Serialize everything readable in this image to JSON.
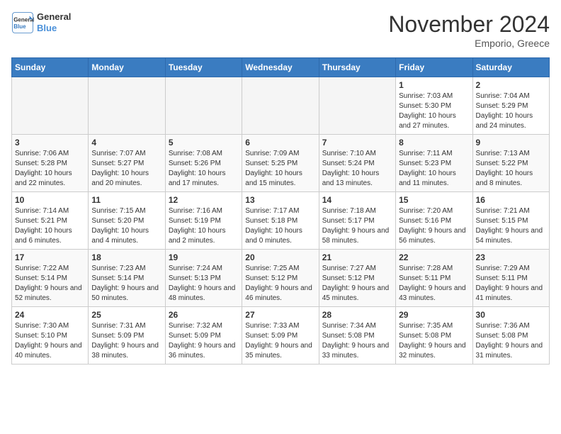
{
  "header": {
    "logo_line1": "General",
    "logo_line2": "Blue",
    "month_title": "November 2024",
    "location": "Emporio, Greece"
  },
  "weekdays": [
    "Sunday",
    "Monday",
    "Tuesday",
    "Wednesday",
    "Thursday",
    "Friday",
    "Saturday"
  ],
  "weeks": [
    [
      {
        "day": "",
        "info": ""
      },
      {
        "day": "",
        "info": ""
      },
      {
        "day": "",
        "info": ""
      },
      {
        "day": "",
        "info": ""
      },
      {
        "day": "",
        "info": ""
      },
      {
        "day": "1",
        "info": "Sunrise: 7:03 AM\nSunset: 5:30 PM\nDaylight: 10 hours and 27 minutes."
      },
      {
        "day": "2",
        "info": "Sunrise: 7:04 AM\nSunset: 5:29 PM\nDaylight: 10 hours and 24 minutes."
      }
    ],
    [
      {
        "day": "3",
        "info": "Sunrise: 7:06 AM\nSunset: 5:28 PM\nDaylight: 10 hours and 22 minutes."
      },
      {
        "day": "4",
        "info": "Sunrise: 7:07 AM\nSunset: 5:27 PM\nDaylight: 10 hours and 20 minutes."
      },
      {
        "day": "5",
        "info": "Sunrise: 7:08 AM\nSunset: 5:26 PM\nDaylight: 10 hours and 17 minutes."
      },
      {
        "day": "6",
        "info": "Sunrise: 7:09 AM\nSunset: 5:25 PM\nDaylight: 10 hours and 15 minutes."
      },
      {
        "day": "7",
        "info": "Sunrise: 7:10 AM\nSunset: 5:24 PM\nDaylight: 10 hours and 13 minutes."
      },
      {
        "day": "8",
        "info": "Sunrise: 7:11 AM\nSunset: 5:23 PM\nDaylight: 10 hours and 11 minutes."
      },
      {
        "day": "9",
        "info": "Sunrise: 7:13 AM\nSunset: 5:22 PM\nDaylight: 10 hours and 8 minutes."
      }
    ],
    [
      {
        "day": "10",
        "info": "Sunrise: 7:14 AM\nSunset: 5:21 PM\nDaylight: 10 hours and 6 minutes."
      },
      {
        "day": "11",
        "info": "Sunrise: 7:15 AM\nSunset: 5:20 PM\nDaylight: 10 hours and 4 minutes."
      },
      {
        "day": "12",
        "info": "Sunrise: 7:16 AM\nSunset: 5:19 PM\nDaylight: 10 hours and 2 minutes."
      },
      {
        "day": "13",
        "info": "Sunrise: 7:17 AM\nSunset: 5:18 PM\nDaylight: 10 hours and 0 minutes."
      },
      {
        "day": "14",
        "info": "Sunrise: 7:18 AM\nSunset: 5:17 PM\nDaylight: 9 hours and 58 minutes."
      },
      {
        "day": "15",
        "info": "Sunrise: 7:20 AM\nSunset: 5:16 PM\nDaylight: 9 hours and 56 minutes."
      },
      {
        "day": "16",
        "info": "Sunrise: 7:21 AM\nSunset: 5:15 PM\nDaylight: 9 hours and 54 minutes."
      }
    ],
    [
      {
        "day": "17",
        "info": "Sunrise: 7:22 AM\nSunset: 5:14 PM\nDaylight: 9 hours and 52 minutes."
      },
      {
        "day": "18",
        "info": "Sunrise: 7:23 AM\nSunset: 5:14 PM\nDaylight: 9 hours and 50 minutes."
      },
      {
        "day": "19",
        "info": "Sunrise: 7:24 AM\nSunset: 5:13 PM\nDaylight: 9 hours and 48 minutes."
      },
      {
        "day": "20",
        "info": "Sunrise: 7:25 AM\nSunset: 5:12 PM\nDaylight: 9 hours and 46 minutes."
      },
      {
        "day": "21",
        "info": "Sunrise: 7:27 AM\nSunset: 5:12 PM\nDaylight: 9 hours and 45 minutes."
      },
      {
        "day": "22",
        "info": "Sunrise: 7:28 AM\nSunset: 5:11 PM\nDaylight: 9 hours and 43 minutes."
      },
      {
        "day": "23",
        "info": "Sunrise: 7:29 AM\nSunset: 5:11 PM\nDaylight: 9 hours and 41 minutes."
      }
    ],
    [
      {
        "day": "24",
        "info": "Sunrise: 7:30 AM\nSunset: 5:10 PM\nDaylight: 9 hours and 40 minutes."
      },
      {
        "day": "25",
        "info": "Sunrise: 7:31 AM\nSunset: 5:09 PM\nDaylight: 9 hours and 38 minutes."
      },
      {
        "day": "26",
        "info": "Sunrise: 7:32 AM\nSunset: 5:09 PM\nDaylight: 9 hours and 36 minutes."
      },
      {
        "day": "27",
        "info": "Sunrise: 7:33 AM\nSunset: 5:09 PM\nDaylight: 9 hours and 35 minutes."
      },
      {
        "day": "28",
        "info": "Sunrise: 7:34 AM\nSunset: 5:08 PM\nDaylight: 9 hours and 33 minutes."
      },
      {
        "day": "29",
        "info": "Sunrise: 7:35 AM\nSunset: 5:08 PM\nDaylight: 9 hours and 32 minutes."
      },
      {
        "day": "30",
        "info": "Sunrise: 7:36 AM\nSunset: 5:08 PM\nDaylight: 9 hours and 31 minutes."
      }
    ]
  ]
}
